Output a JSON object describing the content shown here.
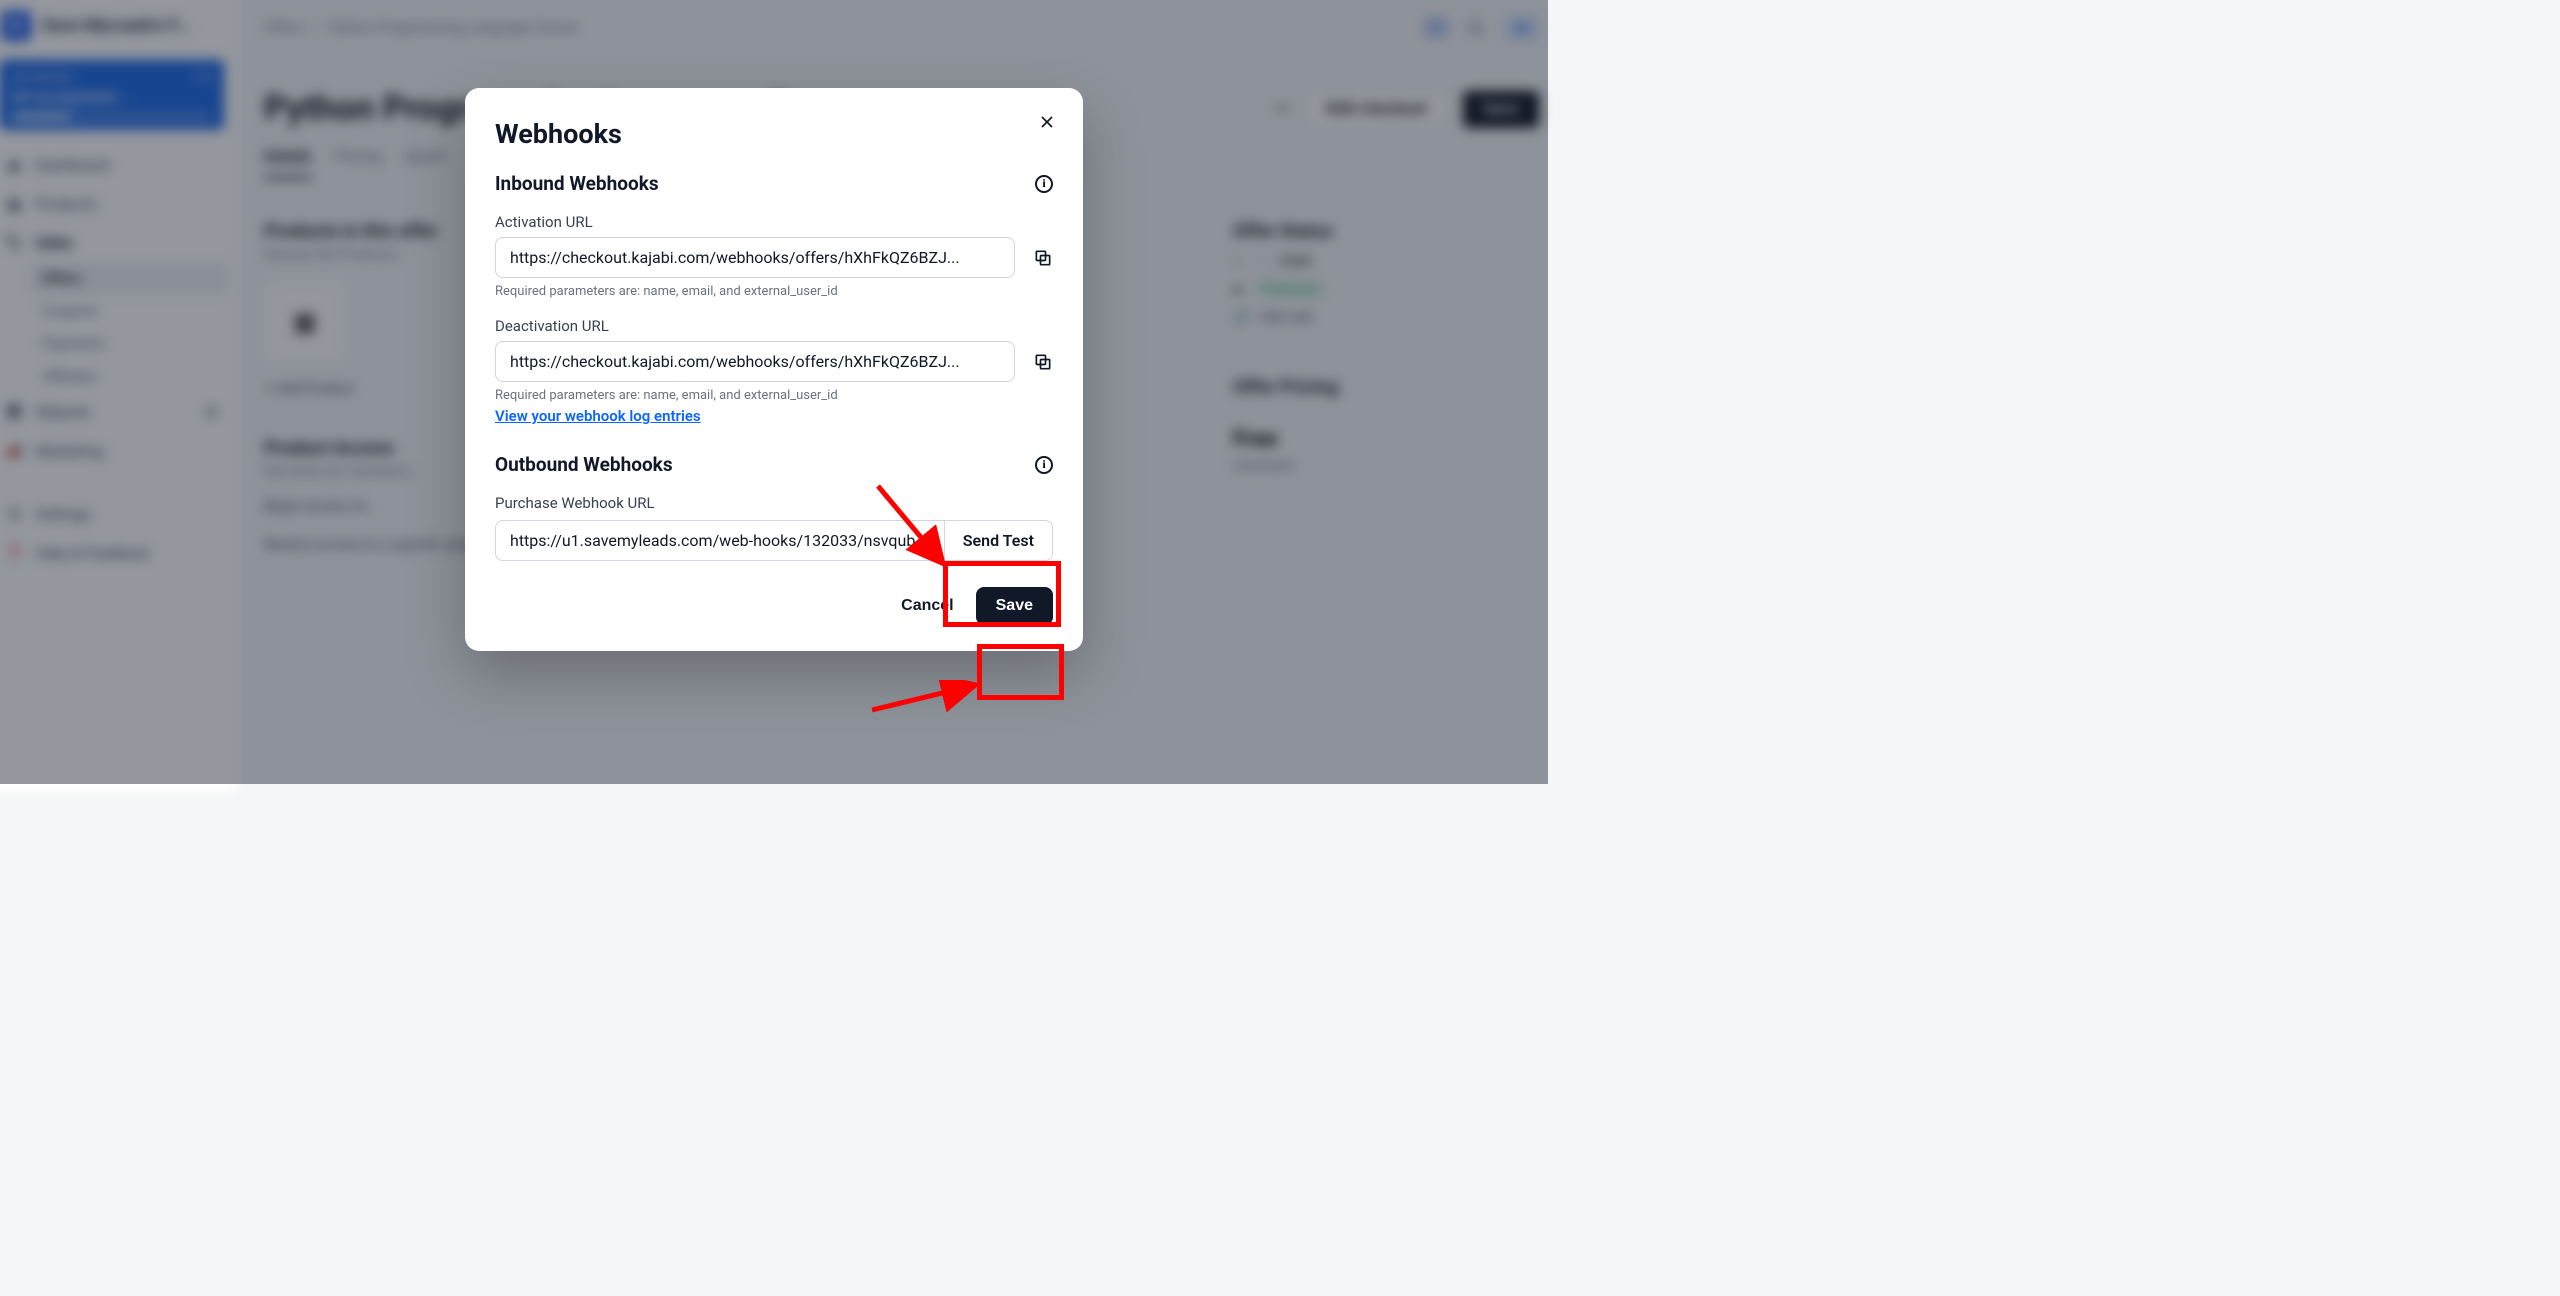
{
  "brand": {
    "logo_letter": "K",
    "name": "Save MyLeads's F..."
  },
  "get_started": {
    "title": "Get Started",
    "count": "1/4",
    "body": "Set up payments →"
  },
  "sidebar": {
    "items": [
      {
        "label": "Dashboard"
      },
      {
        "label": "Products"
      },
      {
        "label": "Sales"
      },
      {
        "label": "Website"
      },
      {
        "label": "Marketing"
      },
      {
        "label": "Settings"
      },
      {
        "label": "Help & Feedback"
      }
    ],
    "sales_sub": [
      {
        "label": "Offers"
      },
      {
        "label": "Coupons"
      },
      {
        "label": "Payments"
      },
      {
        "label": "Affiliates"
      }
    ]
  },
  "topbar": {
    "crumb1": "Offers",
    "crumb_sep": "/",
    "crumb2": "Python Programming Language Course",
    "avatar": "SM"
  },
  "page": {
    "title": "Python Programming Language Course",
    "more": "•••",
    "edit_checkout": "Edit checkout",
    "save": "Save",
    "tabs": [
      "Details",
      "Pricing",
      "Upsell"
    ],
    "products_h": "Products in this offer",
    "products_sub": "Choose the Products...",
    "add_product": "+  Add Product",
    "access_h": "Product Access",
    "access_sub": "Set limits for members...",
    "begin_line": "Begin access at...",
    "restrict_line": "Restrict access to a specific amount of days",
    "right": {
      "status_h": "Offer Status",
      "draft": "Draft",
      "published": "Published",
      "get_link": "Get Link",
      "pricing_h": "Offer Pricing",
      "free": "Free",
      "unlimited": "Unlimited"
    }
  },
  "modal": {
    "title": "Webhooks",
    "inbound_h": "Inbound Webhooks",
    "activation_label": "Activation URL",
    "activation_url": "https://checkout.kajabi.com/webhooks/offers/hXhFkQZ6BZJ...",
    "deactivation_label": "Deactivation URL",
    "deactivation_url": "https://checkout.kajabi.com/webhooks/offers/hXhFkQZ6BZJ...",
    "required_hint": "Required parameters are: name, email, and external_user_id",
    "view_log": "View your webhook log entries",
    "outbound_h": "Outbound Webhooks",
    "purchase_label": "Purchase Webhook URL",
    "purchase_url": "https://u1.savemyleads.com/web-hooks/132033/nsvqub",
    "send_test": "Send Test",
    "cancel": "Cancel",
    "save": "Save"
  }
}
